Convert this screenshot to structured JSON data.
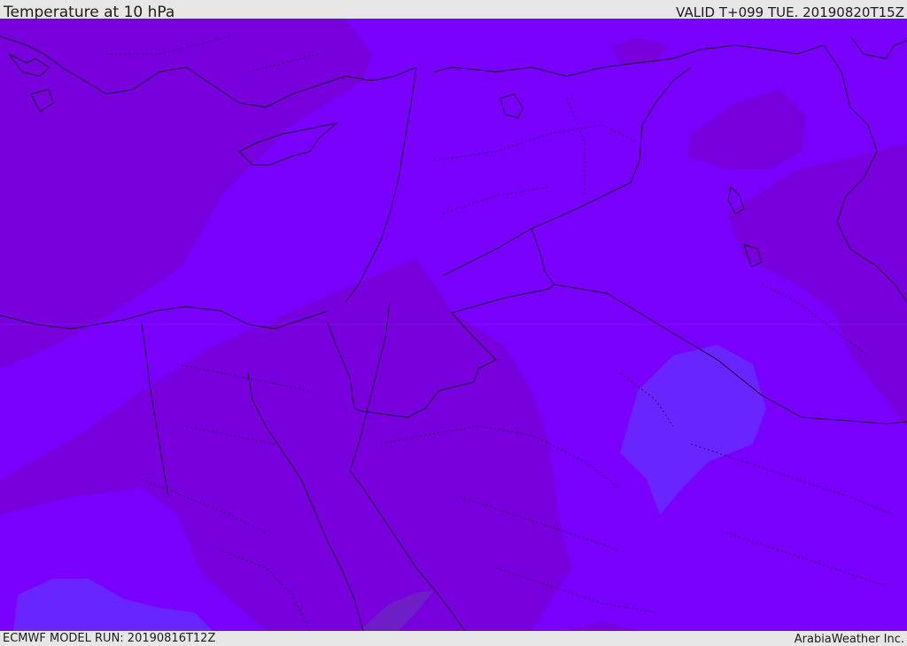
{
  "header": {
    "title": "Temperature at 10 hPa",
    "valid": "VALID T+099 TUE. 20190820T15Z"
  },
  "footer": {
    "model_run": "ECMWF MODEL RUN: 20190816T12Z",
    "credit": "ArabiaWeather Inc."
  },
  "colors": {
    "field_warm": "#7a00fe",
    "field_dark": "#7700dd",
    "field_cool": "#6925ff",
    "field_darkest": "#6e1ec6",
    "coastline": "#1a0033"
  }
}
